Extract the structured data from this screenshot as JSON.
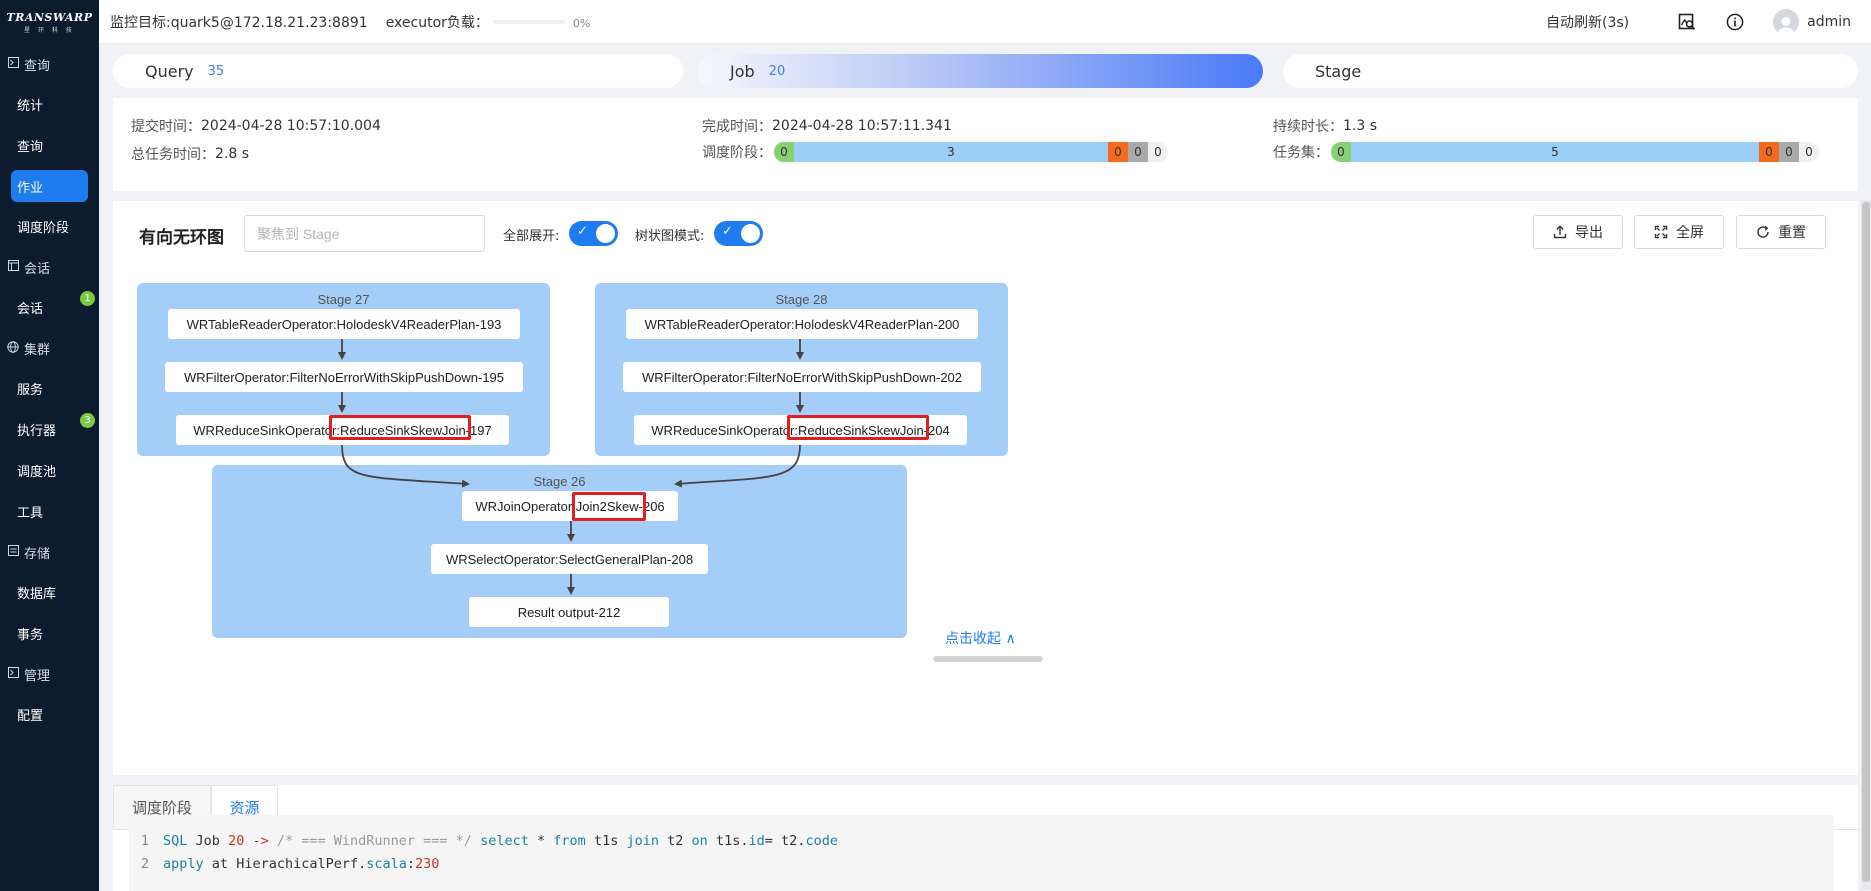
{
  "logo": {
    "brand": "TRANSWARP",
    "sub": "星 环 科 技"
  },
  "sidebar": {
    "groups": [
      {
        "label": "查询",
        "icon": "terminal-icon",
        "items": [
          {
            "label": "统计"
          },
          {
            "label": "查询"
          },
          {
            "label": "作业",
            "active": true
          },
          {
            "label": "调度阶段"
          }
        ]
      },
      {
        "label": "会话",
        "icon": "window-icon",
        "items": [
          {
            "label": "会话",
            "badge": "1"
          }
        ]
      },
      {
        "label": "集群",
        "icon": "globe-icon",
        "items": [
          {
            "label": "服务"
          },
          {
            "label": "执行器",
            "badge": "3"
          },
          {
            "label": "调度池"
          },
          {
            "label": "工具"
          }
        ]
      },
      {
        "label": "存储",
        "icon": "storage-icon",
        "items": [
          {
            "label": "数据库"
          },
          {
            "label": "事务"
          }
        ]
      },
      {
        "label": "管理",
        "icon": "terminal-icon",
        "items": [
          {
            "label": "配置"
          }
        ]
      }
    ]
  },
  "topbar": {
    "target": "监控目标:quark5@172.18.21.23:8891",
    "executor_label": "executor负载：",
    "executor_pct": "0%",
    "executor_load": 0,
    "auto_refresh": "自动刷新(3s)",
    "user": "admin"
  },
  "tabs": [
    {
      "label": "Query",
      "count": "35"
    },
    {
      "label": "Job",
      "count": "20",
      "active": true
    },
    {
      "label": "Stage",
      "count": ""
    }
  ],
  "info": {
    "submit_label": "提交时间：",
    "submit_value": "2024-04-28 10:57:10.004",
    "total_label": "总任务时间：",
    "total_value": "2.8 s",
    "finish_label": "完成时间：",
    "finish_value": "2024-04-28 10:57:11.341",
    "stages_label": "调度阶段：",
    "stages": {
      "success": "0",
      "running": "3",
      "failed": "0",
      "skipped": "0",
      "other": "0"
    },
    "duration_label": "持续时长：",
    "duration_value": "1.3 s",
    "tasks_label": "任务集：",
    "tasks": {
      "success": "0",
      "running": "5",
      "failed": "0",
      "skipped": "0",
      "other": "0"
    }
  },
  "dag": {
    "title": "有向无环图",
    "focus_placeholder": "聚焦到 Stage",
    "expand_label": "全部展开:",
    "tree_label": "树状图模式:",
    "export_label": "导出",
    "fullscreen_label": "全屏",
    "reset_label": "重置",
    "collapse_label": "点击收起 ∧",
    "stages": [
      {
        "title": "Stage 27",
        "ops": [
          "WRTableReaderOperator:HolodeskV4ReaderPlan-193",
          "WRFilterOperator:FilterNoErrorWithSkipPushDown-195",
          "WRReduceSinkOperator:ReduceSinkSkewJoin-197"
        ]
      },
      {
        "title": "Stage 28",
        "ops": [
          "WRTableReaderOperator:HolodeskV4ReaderPlan-200",
          "WRFilterOperator:FilterNoErrorWithSkipPushDown-202",
          "WRReduceSinkOperator:ReduceSinkSkewJoin-204"
        ]
      },
      {
        "title": "Stage 26",
        "ops": [
          "WRJoinOperator:Join2Skew-206",
          "WRSelectOperator:SelectGeneralPlan-208",
          "Result output-212"
        ]
      }
    ]
  },
  "bottom": {
    "tabs": [
      {
        "label": "调度阶段"
      },
      {
        "label": "资源",
        "active": true
      }
    ],
    "code": [
      {
        "n": "1",
        "t": [
          "SQL",
          "Job",
          "20",
          "->",
          "/* === WindRunner === */",
          "select",
          "*",
          "from",
          "t1s",
          "join",
          "t2",
          "on",
          "t1s",
          ".",
          "id",
          "=",
          "t2",
          ".",
          "code"
        ]
      },
      {
        "n": "2",
        "t": [
          "apply",
          "at",
          "HierachicalPerf",
          ".",
          "scala",
          ":",
          "230"
        ]
      }
    ]
  }
}
